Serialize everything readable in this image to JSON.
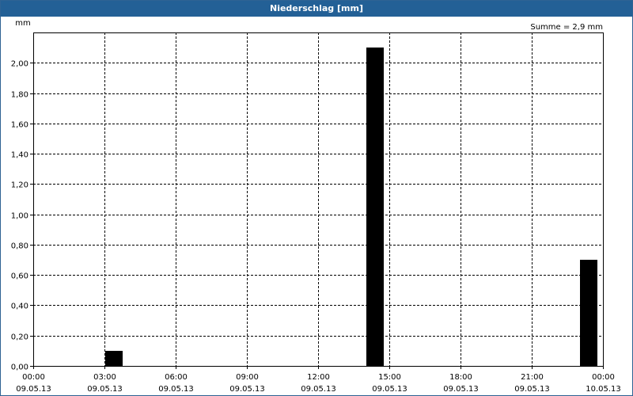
{
  "window": {
    "title": "Niederschlag [mm]"
  },
  "chart_data": {
    "type": "bar",
    "title": "Niederschlag [mm]",
    "ylabel": "mm",
    "xlabel": "",
    "summary": "Summe = 2,9 mm",
    "ylim": [
      0,
      2.2
    ],
    "y_ticks": [
      {
        "value": 0.0,
        "label": "0,00"
      },
      {
        "value": 0.2,
        "label": "0,20"
      },
      {
        "value": 0.4,
        "label": "0,40"
      },
      {
        "value": 0.6,
        "label": "0,60"
      },
      {
        "value": 0.8,
        "label": "0,80"
      },
      {
        "value": 1.0,
        "label": "1,00"
      },
      {
        "value": 1.2,
        "label": "1,20"
      },
      {
        "value": 1.4,
        "label": "1,40"
      },
      {
        "value": 1.6,
        "label": "1,60"
      },
      {
        "value": 1.8,
        "label": "1,80"
      },
      {
        "value": 2.0,
        "label": "2,00"
      }
    ],
    "xlim": [
      "09.05.13 00:00",
      "10.05.13 00:00"
    ],
    "x_ticks": [
      {
        "hour": 0,
        "time": "00:00",
        "date": "09.05.13"
      },
      {
        "hour": 3,
        "time": "03:00",
        "date": "09.05.13"
      },
      {
        "hour": 6,
        "time": "06:00",
        "date": "09.05.13"
      },
      {
        "hour": 9,
        "time": "09:00",
        "date": "09.05.13"
      },
      {
        "hour": 12,
        "time": "12:00",
        "date": "09.05.13"
      },
      {
        "hour": 15,
        "time": "15:00",
        "date": "09.05.13"
      },
      {
        "hour": 18,
        "time": "18:00",
        "date": "09.05.13"
      },
      {
        "hour": 21,
        "time": "21:00",
        "date": "09.05.13"
      },
      {
        "hour": 24,
        "time": "00:00",
        "date": "10.05.13"
      }
    ],
    "series": [
      {
        "values": [
          {
            "start": "09.05.13 03:00",
            "end": "09.05.13 03:45",
            "value": 0.1
          },
          {
            "start": "09.05.13 14:00",
            "end": "09.05.13 14:45",
            "value": 2.1
          },
          {
            "start": "09.05.13 23:00",
            "end": "09.05.13 23:45",
            "value": 0.7
          }
        ]
      }
    ],
    "grid": true,
    "grid_style": "dashed",
    "bar_color": "#000000"
  }
}
